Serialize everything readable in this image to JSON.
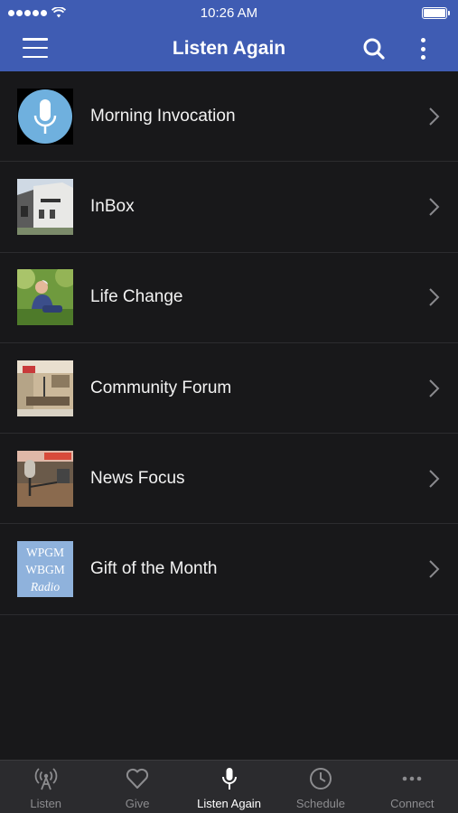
{
  "status": {
    "time": "10:26 AM",
    "signal_icon": "signal-dots-icon",
    "wifi_icon": "wifi-icon",
    "battery_icon": "battery-icon"
  },
  "header": {
    "title": "Listen Again",
    "menu_icon": "hamburger-menu-icon",
    "search_icon": "search-icon",
    "more_icon": "more-vertical-icon",
    "background_color": "#3f5cb3"
  },
  "programs": [
    {
      "label": "Morning Invocation",
      "thumb": "microphone-thumbnail"
    },
    {
      "label": "InBox",
      "thumb": "building-photo-thumbnail"
    },
    {
      "label": "Life Change",
      "thumb": "person-photo-thumbnail"
    },
    {
      "label": "Community Forum",
      "thumb": "studio-photo-thumbnail"
    },
    {
      "label": "News Focus",
      "thumb": "microphone-photo-thumbnail"
    },
    {
      "label": "Gift of the Month",
      "thumb": "station-logo-thumbnail",
      "logo_lines": [
        "WPGM",
        "WBGM",
        "Radio"
      ]
    }
  ],
  "tabs": [
    {
      "label": "Listen",
      "icon": "broadcast-icon",
      "active": false
    },
    {
      "label": "Give",
      "icon": "heart-icon",
      "active": false
    },
    {
      "label": "Listen Again",
      "icon": "microphone-icon",
      "active": true
    },
    {
      "label": "Schedule",
      "icon": "clock-icon",
      "active": false
    },
    {
      "label": "Connect",
      "icon": "more-horizontal-icon",
      "active": false
    }
  ]
}
